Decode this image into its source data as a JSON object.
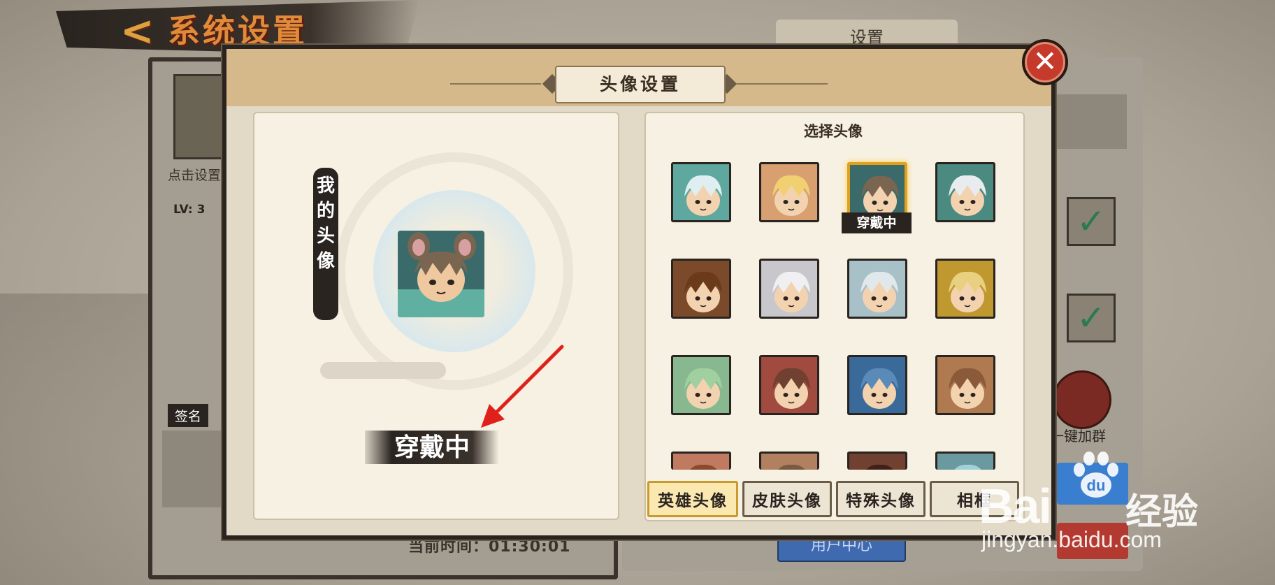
{
  "header": {
    "back_icon": "chevron-left-icon",
    "title": "系统设置"
  },
  "background": {
    "settings_tab": "设置",
    "click_to_set": "点击设置",
    "level": "LV: 3",
    "signature_label": "签名",
    "current_time": "当前时间：01:30:01",
    "user_center": "用户中心",
    "join_group": "一键加群",
    "check_icon": "check-icon"
  },
  "modal": {
    "title": "头像设置",
    "close_icon": "close-icon",
    "my_avatar_label": "我的头像",
    "wearing_label": "穿戴中",
    "choose_label": "选择头像",
    "avatars": [
      {
        "name": "white-dragon-hero",
        "color": "#5fa8a0",
        "hair": "#dfeef0",
        "selected": false
      },
      {
        "name": "golden-hair-hero",
        "color": "#d8a070",
        "hair": "#f0d070",
        "selected": false
      },
      {
        "name": "mouse-ear-hero",
        "color": "#3a6a6a",
        "hair": "#7a6650",
        "selected": true,
        "tag": "穿戴中"
      },
      {
        "name": "fox-mask-hero",
        "color": "#4a8a80",
        "hair": "#e8ecef",
        "selected": false
      },
      {
        "name": "monkey-king-hero",
        "color": "#7a4a2a",
        "hair": "#6a3a1a",
        "selected": false
      },
      {
        "name": "white-hair-hero",
        "color": "#c8c8cc",
        "hair": "#f0f0f2",
        "selected": false
      },
      {
        "name": "ghost-veil-hero",
        "color": "#a8c0c8",
        "hair": "#e0e8ec",
        "selected": false
      },
      {
        "name": "lion-mask-hero",
        "color": "#c09830",
        "hair": "#e8d080",
        "selected": false
      },
      {
        "name": "green-hair-hero",
        "color": "#88b890",
        "hair": "#a0d0a0",
        "selected": false
      },
      {
        "name": "goggles-hero",
        "color": "#a04a40",
        "hair": "#704030",
        "selected": false
      },
      {
        "name": "blue-demon-hero",
        "color": "#3a6a9a",
        "hair": "#5a8ab8",
        "selected": false
      },
      {
        "name": "brown-hair-hero",
        "color": "#b07a50",
        "hair": "#8a5a3a",
        "selected": false
      },
      {
        "name": "row4-hero-1",
        "color": "#c07a60",
        "hair": "#8a4a30",
        "selected": false
      },
      {
        "name": "row4-hero-2",
        "color": "#b08060",
        "hair": "#7a5a40",
        "selected": false
      },
      {
        "name": "row4-hero-3",
        "color": "#704030",
        "hair": "#402018",
        "selected": false
      },
      {
        "name": "row4-hero-4",
        "color": "#6a9aa0",
        "hair": "#a0d0d8",
        "selected": false
      }
    ],
    "tabs": [
      {
        "label": "英雄头像",
        "active": true
      },
      {
        "label": "皮肤头像",
        "active": false
      },
      {
        "label": "特殊头像",
        "active": false
      },
      {
        "label": "相框",
        "active": false
      }
    ]
  },
  "watermark": {
    "brand_left": "Bai",
    "brand_right": "经验",
    "url": "jingyan.baidu.com",
    "paw_icon": "baidu-paw-icon"
  }
}
